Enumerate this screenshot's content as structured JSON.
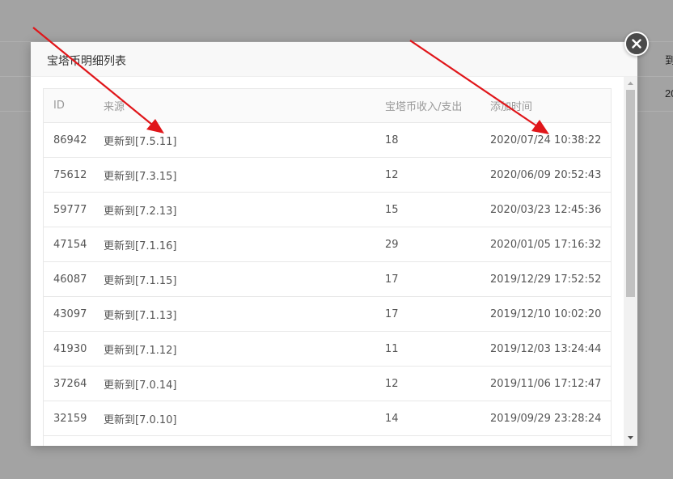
{
  "background": {
    "partial_text_1": "到",
    "partial_text_2": "20"
  },
  "modal": {
    "title": "宝塔币明细列表",
    "close_icon": "close-icon"
  },
  "table": {
    "headers": {
      "id": "ID",
      "source": "来源",
      "coins": "宝塔币收入/支出",
      "time": "添加时间"
    },
    "rows": [
      {
        "id": "86942",
        "source": "更新到[7.5.11]",
        "coins": "18",
        "time": "2020/07/24 10:38:22"
      },
      {
        "id": "75612",
        "source": "更新到[7.3.15]",
        "coins": "12",
        "time": "2020/06/09 20:52:43"
      },
      {
        "id": "59777",
        "source": "更新到[7.2.13]",
        "coins": "15",
        "time": "2020/03/23 12:45:36"
      },
      {
        "id": "47154",
        "source": "更新到[7.1.16]",
        "coins": "29",
        "time": "2020/01/05 17:16:32"
      },
      {
        "id": "46087",
        "source": "更新到[7.1.15]",
        "coins": "17",
        "time": "2019/12/29 17:52:52"
      },
      {
        "id": "43097",
        "source": "更新到[7.1.13]",
        "coins": "17",
        "time": "2019/12/10 10:02:20"
      },
      {
        "id": "41930",
        "source": "更新到[7.1.12]",
        "coins": "11",
        "time": "2019/12/03 13:24:44"
      },
      {
        "id": "37264",
        "source": "更新到[7.0.14]",
        "coins": "12",
        "time": "2019/11/06 17:12:47"
      },
      {
        "id": "32159",
        "source": "更新到[7.0.10]",
        "coins": "14",
        "time": "2019/09/29 23:28:24"
      },
      {
        "id": "",
        "source": "",
        "coins": "",
        "time": ""
      }
    ]
  },
  "annotation_color": "#e0161a"
}
